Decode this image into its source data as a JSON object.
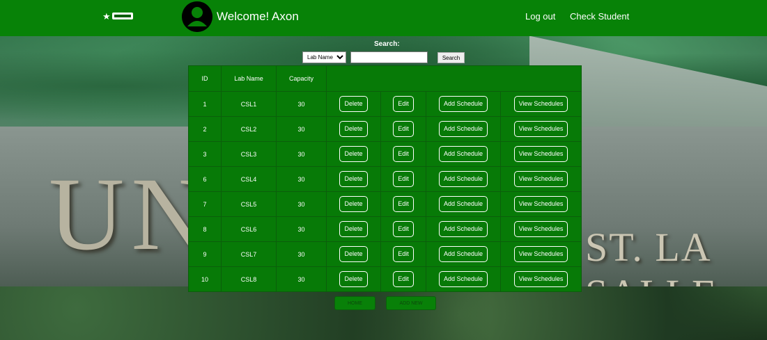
{
  "header": {
    "welcome_text": "Welcome! Axon",
    "nav": {
      "logout": "Log out",
      "check_student": "Check Student"
    }
  },
  "search": {
    "label": "Search:",
    "select_value": "Lab Name",
    "input_value": "",
    "button_label": "Search"
  },
  "table": {
    "columns": [
      "ID",
      "Lab Name",
      "Capacity"
    ],
    "action_labels": {
      "delete": "Delete",
      "edit": "Edit",
      "add_schedule": "Add Schedule",
      "view_schedules": "View Schedules"
    },
    "rows": [
      {
        "id": "1",
        "name": "CSL1",
        "capacity": "30"
      },
      {
        "id": "2",
        "name": "CSL2",
        "capacity": "30"
      },
      {
        "id": "3",
        "name": "CSL3",
        "capacity": "30"
      },
      {
        "id": "6",
        "name": "CSL4",
        "capacity": "30"
      },
      {
        "id": "7",
        "name": "CSL5",
        "capacity": "30"
      },
      {
        "id": "8",
        "name": "CSL6",
        "capacity": "30"
      },
      {
        "id": "9",
        "name": "CSL7",
        "capacity": "30"
      },
      {
        "id": "10",
        "name": "CSL8",
        "capacity": "30"
      }
    ]
  },
  "footer_buttons": {
    "home": "HOME",
    "add_new": "ADD NEW"
  },
  "background": {
    "sign_left": "UN",
    "sign_right": "ST. LA SALLE"
  },
  "colors": {
    "navbar": "#078207",
    "table": "#077a07"
  }
}
